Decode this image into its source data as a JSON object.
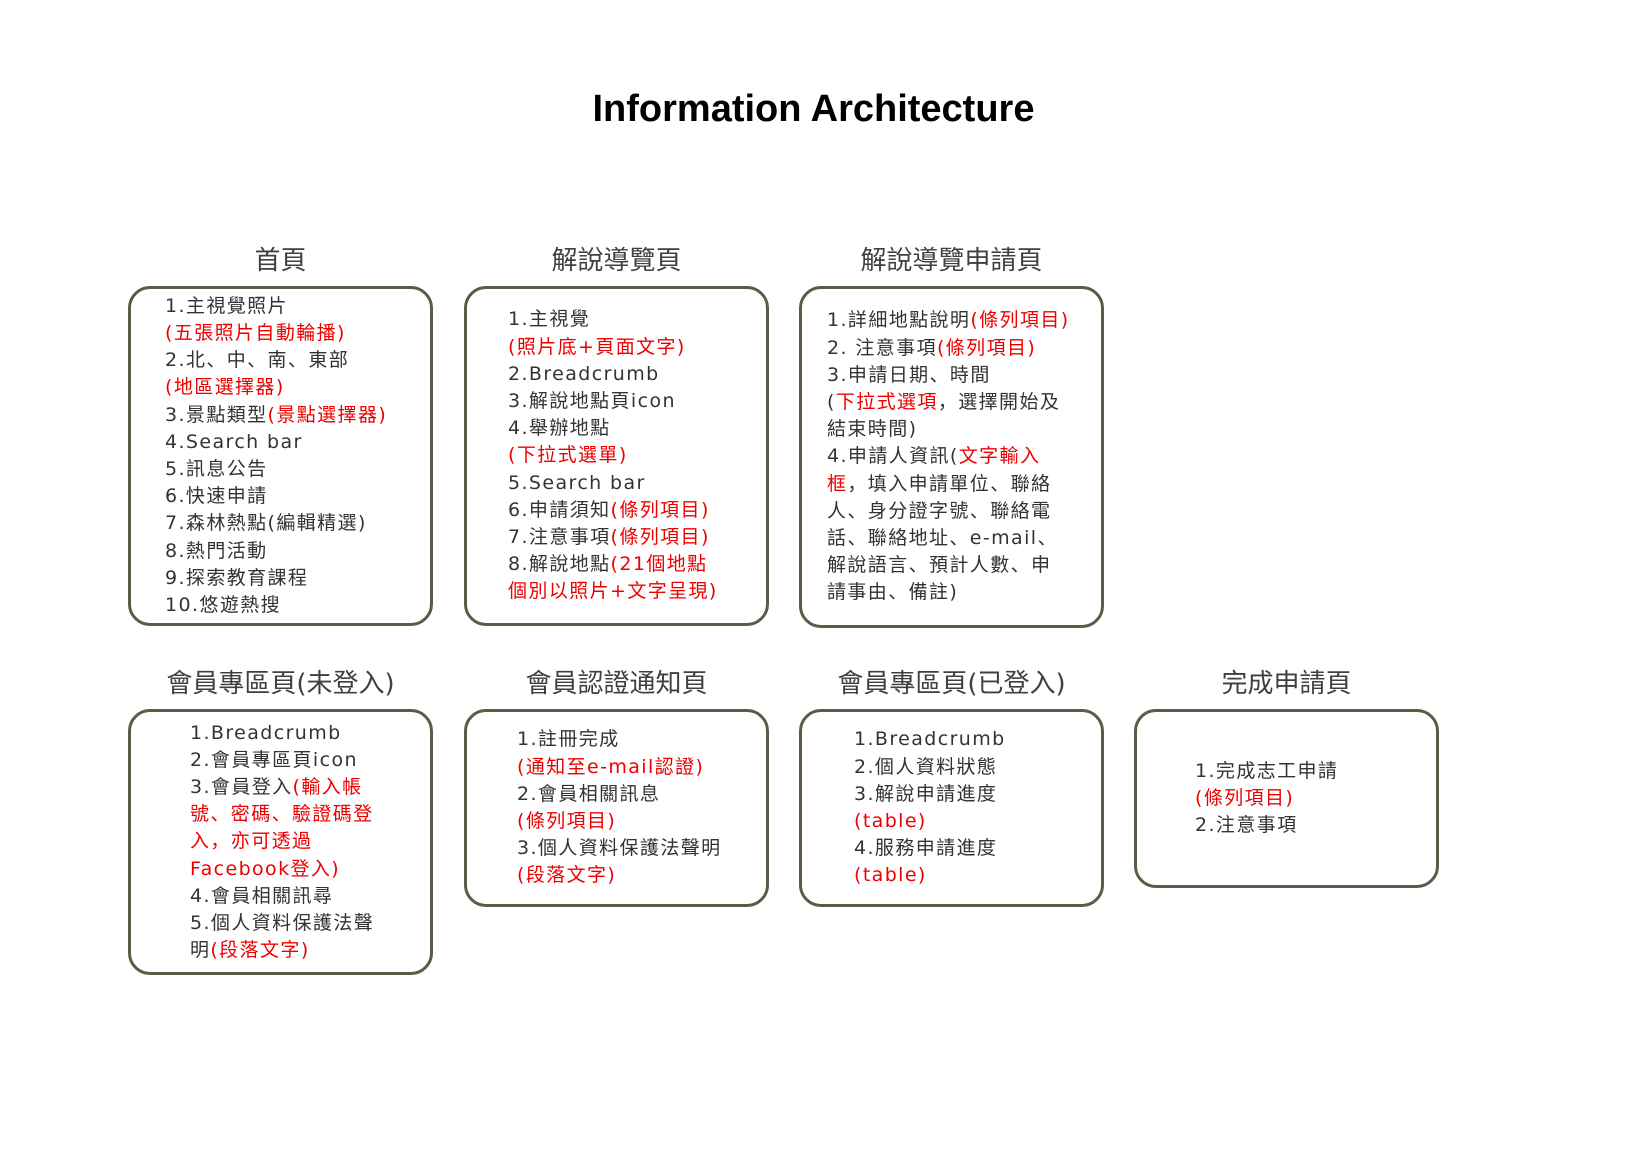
{
  "title": "Information Architecture",
  "accent_color": "#ee0000",
  "border_color": "#5b5b47",
  "pages": [
    {
      "name": "首頁",
      "lines": [
        [
          {
            "t": "1.主視覺照片"
          }
        ],
        [
          {
            "t": "(五張照片自動輪播)",
            "red": true
          }
        ],
        [
          {
            "t": "2.北、中、南、東部"
          }
        ],
        [
          {
            "t": "(地區選擇器)",
            "red": true
          }
        ],
        [
          {
            "t": "3.景點類型"
          },
          {
            "t": "(景點選擇器)",
            "red": true
          }
        ],
        [
          {
            "t": "4.Search bar"
          }
        ],
        [
          {
            "t": "5.訊息公告"
          }
        ],
        [
          {
            "t": "6.快速申請"
          }
        ],
        [
          {
            "t": "7.森林熱點(編輯精選)"
          }
        ],
        [
          {
            "t": "8.熱門活動"
          }
        ],
        [
          {
            "t": "9.探索教育課程"
          }
        ],
        [
          {
            "t": "10.悠遊熱搜"
          }
        ]
      ]
    },
    {
      "name": "解說導覽頁",
      "lines": [
        [
          {
            "t": "1.主視覺"
          }
        ],
        [
          {
            "t": "(照片底+頁面文字)",
            "red": true
          }
        ],
        [
          {
            "t": "2.Breadcrumb"
          }
        ],
        [
          {
            "t": "3.解說地點頁icon"
          }
        ],
        [
          {
            "t": "4.舉辦地點"
          }
        ],
        [
          {
            "t": "(下拉式選單)",
            "red": true
          }
        ],
        [
          {
            "t": "5.Search bar"
          }
        ],
        [
          {
            "t": "6.申請須知"
          },
          {
            "t": "(條列項目)",
            "red": true
          }
        ],
        [
          {
            "t": "7.注意事項"
          },
          {
            "t": "(條列項目)",
            "red": true
          }
        ],
        [
          {
            "t": "8.解說地點"
          },
          {
            "t": "(21個地點",
            "red": true
          }
        ],
        [
          {
            "t": "個別以照片+文字呈現)",
            "red": true
          }
        ]
      ]
    },
    {
      "name": "解說導覽申請頁",
      "lines": [
        [
          {
            "t": "1.詳細地點說明"
          },
          {
            "t": "(條列項目)",
            "red": true
          }
        ],
        [
          {
            "t": "2. 注意事項"
          },
          {
            "t": "(條列項目)",
            "red": true
          }
        ],
        [
          {
            "t": "3.申請日期、時間"
          }
        ],
        [
          {
            "t": "("
          },
          {
            "t": "下拉式選項",
            "red": true
          },
          {
            "t": "，選擇開始及"
          }
        ],
        [
          {
            "t": "結束時間)"
          }
        ],
        [
          {
            "t": "4.申請人資訊("
          },
          {
            "t": "文字輸入",
            "red": true
          }
        ],
        [
          {
            "t": "框",
            "red": true
          },
          {
            "t": "，填入申請單位、聯絡"
          }
        ],
        [
          {
            "t": "人、身分證字號、聯絡電"
          }
        ],
        [
          {
            "t": "話、聯絡地址、e-mail、"
          }
        ],
        [
          {
            "t": "解說語言、預計人數、申"
          }
        ],
        [
          {
            "t": "請事由、備註)"
          }
        ]
      ]
    },
    {
      "name": "會員專區頁(未登入)",
      "lines": [
        [
          {
            "t": "1.Breadcrumb"
          }
        ],
        [
          {
            "t": "2.會員專區頁icon"
          }
        ],
        [
          {
            "t": "3.會員登入"
          },
          {
            "t": "(輸入帳",
            "red": true
          }
        ],
        [
          {
            "t": "號、密碼、驗證碼登",
            "red": true
          }
        ],
        [
          {
            "t": "入，亦可透過",
            "red": true
          }
        ],
        [
          {
            "t": "Facebook登入)",
            "red": true
          }
        ],
        [
          {
            "t": "4.會員相關訊尋"
          }
        ],
        [
          {
            "t": "5.個人資料保護法聲"
          }
        ],
        [
          {
            "t": "明"
          },
          {
            "t": "(段落文字)",
            "red": true
          }
        ]
      ]
    },
    {
      "name": "會員認證通知頁",
      "lines": [
        [
          {
            "t": "1.註冊完成"
          }
        ],
        [
          {
            "t": "(通知至e-mail認證)",
            "red": true
          }
        ],
        [
          {
            "t": "2.會員相關訊息"
          }
        ],
        [
          {
            "t": "(條列項目)",
            "red": true
          }
        ],
        [
          {
            "t": "3.個人資料保護法聲明"
          }
        ],
        [
          {
            "t": "(段落文字)",
            "red": true
          }
        ]
      ]
    },
    {
      "name": "會員專區頁(已登入)",
      "lines": [
        [
          {
            "t": "1.Breadcrumb"
          }
        ],
        [
          {
            "t": "2.個人資料狀態"
          }
        ],
        [
          {
            "t": "3.解說申請進度"
          }
        ],
        [
          {
            "t": "(table)",
            "red": true
          }
        ],
        [
          {
            "t": "4.服務申請進度"
          }
        ],
        [
          {
            "t": "(table)",
            "red": true
          }
        ]
      ]
    },
    {
      "name": "完成申請頁",
      "lines": [
        [
          {
            "t": "1.完成志工申請"
          }
        ],
        [
          {
            "t": "(條列項目)",
            "red": true
          }
        ],
        [
          {
            "t": "2.注意事項"
          }
        ]
      ]
    }
  ]
}
